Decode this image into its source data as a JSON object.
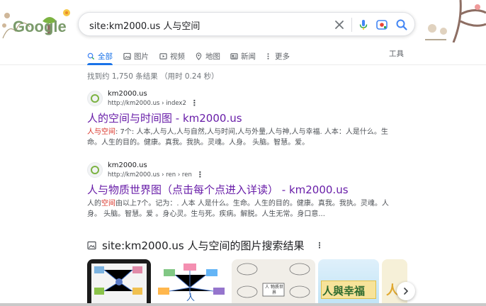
{
  "logo": {
    "text": "Google"
  },
  "search": {
    "query": "site:km2000.us 人与空间"
  },
  "tabs": [
    {
      "label": "全部",
      "icon": "search-icon",
      "active": true
    },
    {
      "label": "图片",
      "icon": "image-icon",
      "active": false
    },
    {
      "label": "视频",
      "icon": "video-icon",
      "active": false
    },
    {
      "label": "地图",
      "icon": "map-pin-icon",
      "active": false
    },
    {
      "label": "新闻",
      "icon": "news-icon",
      "active": false
    },
    {
      "label": "更多",
      "icon": "more-vert-icon",
      "active": false
    }
  ],
  "tools_label": "工具",
  "stats": "找到约 1,750 条结果  （用时 0.24 秒）",
  "results": [
    {
      "site_name": "km2000.us",
      "url": "http://km2000.us › index2",
      "title": "人的空间与时间图 - km2000.us",
      "snippet_highlight": "人与空间",
      "snippet": ": 7个: 人本,人与人,人与自然,人与时间,人与外量,人与神,人与幸福. 人本：人是什么。生命。人生的目的。健康。真我。我执。灵魂。人身。 头脑。智慧。爱。"
    },
    {
      "site_name": "km2000.us",
      "url": "http://km2000.us › ren › ren",
      "title": "人与物质世界图（点击每个点进入详读） - km2000.us",
      "snippet_pre": "人的",
      "snippet_highlight": "空间",
      "snippet": "由以上7个。记为：. 人本 人是什么。生命。人生的目的。健康。真我。我执。灵魂。人身。 头脑。智慧。爱 。身心灵。生与死。疾病。解脱。人生无常。身口意..."
    }
  ],
  "images_section": {
    "title": "site:km2000.us 人与空间的图片搜索结果",
    "thumbnails": [
      {
        "label": ""
      },
      {
        "label": ""
      },
      {
        "label": "人 物质世界"
      },
      {
        "label": "人與幸福"
      },
      {
        "label": "人"
      }
    ]
  },
  "colors": {
    "link_visited": "#681da8",
    "accent_blue": "#1a73e8",
    "highlight_red": "#d93025"
  }
}
